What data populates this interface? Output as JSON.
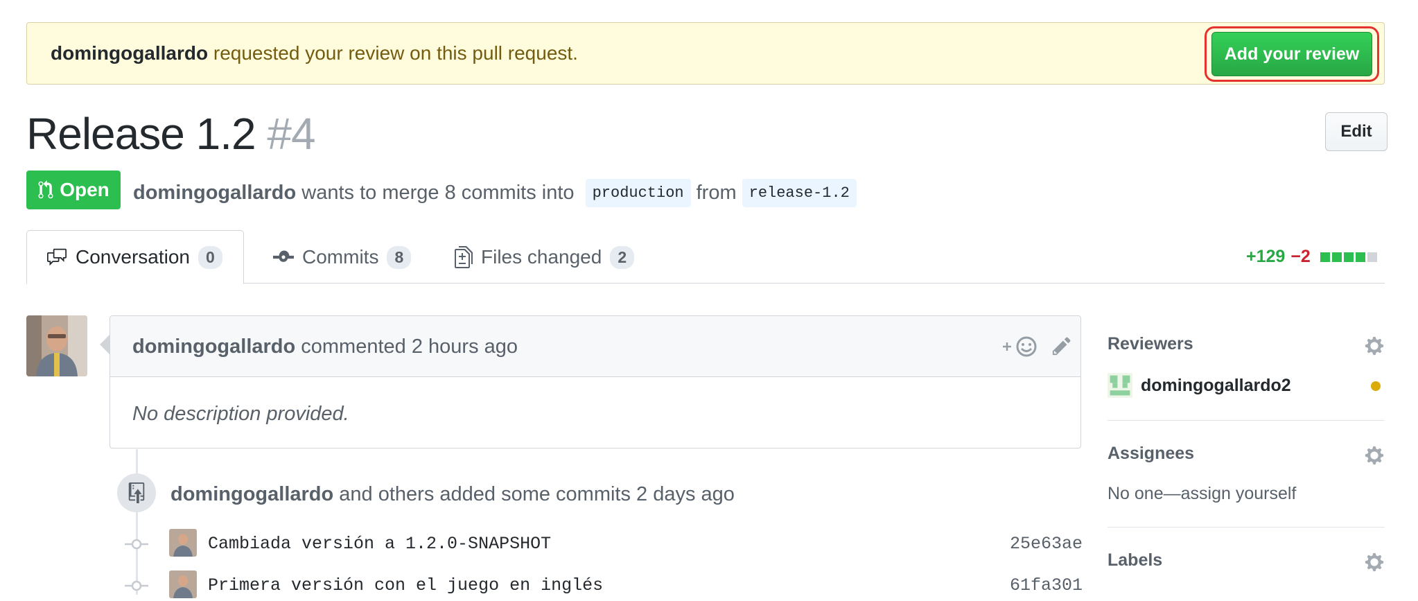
{
  "banner": {
    "user": "domingogallardo",
    "message": " requested your review on this pull request.",
    "button_label": "Add your review"
  },
  "pr": {
    "title": "Release 1.2",
    "number": "#4",
    "edit_label": "Edit",
    "state": "Open",
    "author": "domingogallardo",
    "merge_text": " wants to merge 8 commits into ",
    "base_branch": "production",
    "from_text": "from",
    "head_branch": "release-1.2"
  },
  "tabs": [
    {
      "label": "Conversation",
      "count": "0",
      "icon": "comment-discussion-icon"
    },
    {
      "label": "Commits",
      "count": "8",
      "icon": "git-commit-icon"
    },
    {
      "label": "Files changed",
      "count": "2",
      "icon": "file-diff-icon"
    }
  ],
  "diffstat": {
    "additions": "+129",
    "deletions": "−2",
    "added_blocks": 4,
    "neutral_blocks": 1
  },
  "comment": {
    "author": "domingogallardo",
    "meta": " commented 2 hours ago",
    "body": "No description provided.",
    "reaction_icon": "smiley-icon",
    "edit_icon": "pencil-icon"
  },
  "timeline": {
    "author": "domingogallardo",
    "meta": " and others added some commits 2 days ago",
    "commits": [
      {
        "message": "Cambiada versión a 1.2.0-SNAPSHOT",
        "sha": "25e63ae"
      },
      {
        "message": "Primera versión con el juego en inglés",
        "sha": "61fa301"
      }
    ]
  },
  "sidebar": {
    "reviewers": {
      "title": "Reviewers",
      "name": "domingogallardo2"
    },
    "assignees": {
      "title": "Assignees",
      "value": "No one—assign yourself"
    },
    "labels": {
      "title": "Labels"
    }
  },
  "colors": {
    "green": "#2cbe4e",
    "red": "#cb2431",
    "pending": "#dbab09",
    "banner_bg": "#fffbdd"
  }
}
